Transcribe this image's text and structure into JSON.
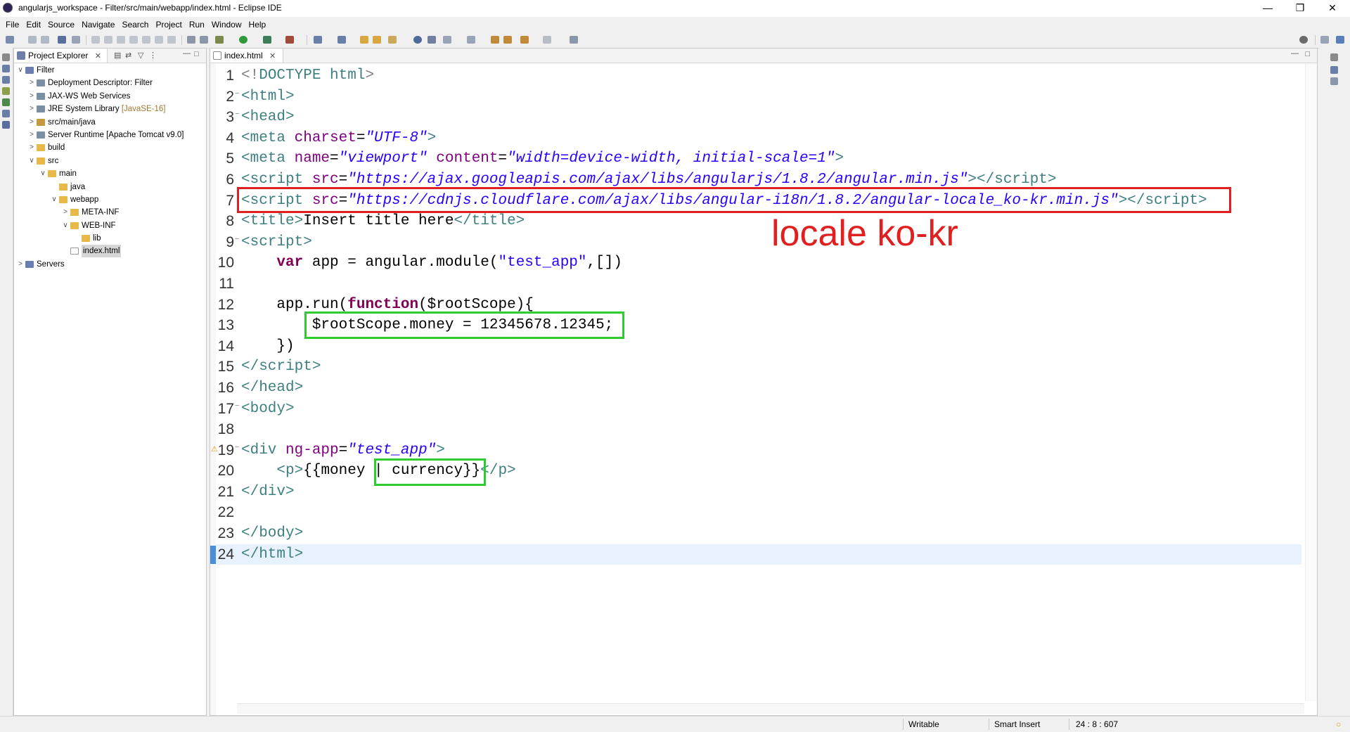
{
  "window": {
    "title": "angularjs_workspace - Filter/src/main/webapp/index.html - Eclipse IDE",
    "minimize": "—",
    "restore": "❒",
    "close": "✕"
  },
  "menu": [
    "File",
    "Edit",
    "Source",
    "Navigate",
    "Search",
    "Project",
    "Run",
    "Window",
    "Help"
  ],
  "explorer": {
    "tab_label": "Project Explorer",
    "tab_close": "✕",
    "tree": [
      {
        "label": "Filter",
        "chev": "∨",
        "icon": "proj",
        "depth": 0
      },
      {
        "label": "Deployment Descriptor: Filter",
        "chev": ">",
        "icon": "lib",
        "depth": 1
      },
      {
        "label": "JAX-WS Web Services",
        "chev": ">",
        "icon": "lib",
        "depth": 1
      },
      {
        "label": "JRE System Library",
        "decor": "[JavaSE-16]",
        "chev": ">",
        "icon": "lib",
        "depth": 1
      },
      {
        "label": "src/main/java",
        "chev": ">",
        "icon": "srcf",
        "depth": 1
      },
      {
        "label": "Server Runtime [Apache Tomcat v9.0]",
        "chev": ">",
        "icon": "lib",
        "depth": 1
      },
      {
        "label": "build",
        "chev": ">",
        "icon": "folder",
        "depth": 1
      },
      {
        "label": "src",
        "chev": "∨",
        "icon": "folder",
        "depth": 1
      },
      {
        "label": "main",
        "chev": "∨",
        "icon": "folder",
        "depth": 2
      },
      {
        "label": "java",
        "chev": "",
        "icon": "folder",
        "depth": 3
      },
      {
        "label": "webapp",
        "chev": "∨",
        "icon": "folder",
        "depth": 3
      },
      {
        "label": "META-INF",
        "chev": ">",
        "icon": "folder",
        "depth": 4
      },
      {
        "label": "WEB-INF",
        "chev": "∨",
        "icon": "folder",
        "depth": 4
      },
      {
        "label": "lib",
        "chev": "",
        "icon": "folder",
        "depth": 5
      },
      {
        "label": "index.html",
        "chev": "",
        "icon": "file",
        "depth": 4,
        "selected": true
      },
      {
        "label": "Servers",
        "chev": ">",
        "icon": "proj",
        "depth": 0
      }
    ]
  },
  "editor": {
    "tab_label": "index.html",
    "tab_close": "✕",
    "annotation_text": "locale ko-kr",
    "lines": [
      {
        "n": "1",
        "html": "<span class=\"grey\">&lt;!</span><span class=\"tag\">DOCTYPE html</span><span class=\"grey\">&gt;</span>"
      },
      {
        "n": "2",
        "fold": "−",
        "html": "<span class=\"tag\">&lt;html&gt;</span>"
      },
      {
        "n": "3",
        "fold": "−",
        "html": "<span class=\"tag\">&lt;head&gt;</span>"
      },
      {
        "n": "4",
        "html": "<span class=\"tag\">&lt;meta </span><span class=\"attr\">charset</span>=<span class=\"aval\">\"UTF-8\"</span><span class=\"tag\">&gt;</span>"
      },
      {
        "n": "5",
        "html": "<span class=\"tag\">&lt;meta </span><span class=\"attr\">name</span>=<span class=\"aval\">\"viewport\"</span> <span class=\"attr\">content</span>=<span class=\"aval\">\"width=device-width, initial-scale=1\"</span><span class=\"tag\">&gt;</span>"
      },
      {
        "n": "6",
        "html": "<span class=\"tag\">&lt;script </span><span class=\"attr\">src</span>=<span class=\"aval\">\"https://ajax.googleapis.com/ajax/libs/angularjs/1.8.2/angular.min.js\"</span><span class=\"tag\">&gt;&lt;/script&gt;</span>"
      },
      {
        "n": "7",
        "html": "<span class=\"tag\">&lt;script </span><span class=\"attr\">src</span>=<span class=\"aval\">\"https://cdnjs.cloudflare.com/ajax/libs/angular-i18n/1.8.2/angular-locale_ko-kr.min.js\"</span><span class=\"tag\">&gt;&lt;/script&gt;</span>"
      },
      {
        "n": "8",
        "html": "<span class=\"tag\">&lt;title&gt;</span>Insert title here<span class=\"tag\">&lt;/title&gt;</span>"
      },
      {
        "n": "9",
        "fold": "−",
        "html": "<span class=\"tag\">&lt;script&gt;</span>"
      },
      {
        "n": "10",
        "html": "    <span class=\"kw\">var</span> app = angular.module(<span class=\"str\">\"test_app\"</span>,[])"
      },
      {
        "n": "11",
        "html": ""
      },
      {
        "n": "12",
        "html": "    app.run(<span class=\"kw\">function</span>($rootScope){"
      },
      {
        "n": "13",
        "html": "        $rootScope.money = 12345678.12345;"
      },
      {
        "n": "14",
        "html": "    })"
      },
      {
        "n": "15",
        "html": "<span class=\"tag\">&lt;/script&gt;</span>"
      },
      {
        "n": "16",
        "html": "<span class=\"tag\">&lt;/head&gt;</span>"
      },
      {
        "n": "17",
        "fold": "−",
        "html": "<span class=\"tag\">&lt;body&gt;</span>"
      },
      {
        "n": "18",
        "html": ""
      },
      {
        "n": "19",
        "fold": "−",
        "warn": true,
        "html": "<span class=\"tag\">&lt;div </span><span class=\"attr\">ng-app</span>=<span class=\"aval\">\"test_app\"</span><span class=\"tag\">&gt;</span>"
      },
      {
        "n": "20",
        "html": "    <span class=\"tag\">&lt;p&gt;</span>{{money | currency}}<span class=\"tag\">&lt;/p&gt;</span>"
      },
      {
        "n": "21",
        "html": "<span class=\"tag\">&lt;/div&gt;</span>"
      },
      {
        "n": "22",
        "html": ""
      },
      {
        "n": "23",
        "html": "<span class=\"tag\">&lt;/body&gt;</span>"
      },
      {
        "n": "24",
        "current": true,
        "html": "<span class=\"tag\">&lt;/html&gt;</span>"
      }
    ]
  },
  "status": {
    "writable": "Writable",
    "insert_mode": "Smart Insert",
    "position": "24 : 8 : 607"
  },
  "colors": {
    "highlight_red": "#e02020",
    "highlight_green": "#2ecc2e",
    "tag": "#3f7f7f",
    "attribute": "#7f007f",
    "attribute_value": "#2a00ff",
    "keyword": "#7f0055"
  }
}
